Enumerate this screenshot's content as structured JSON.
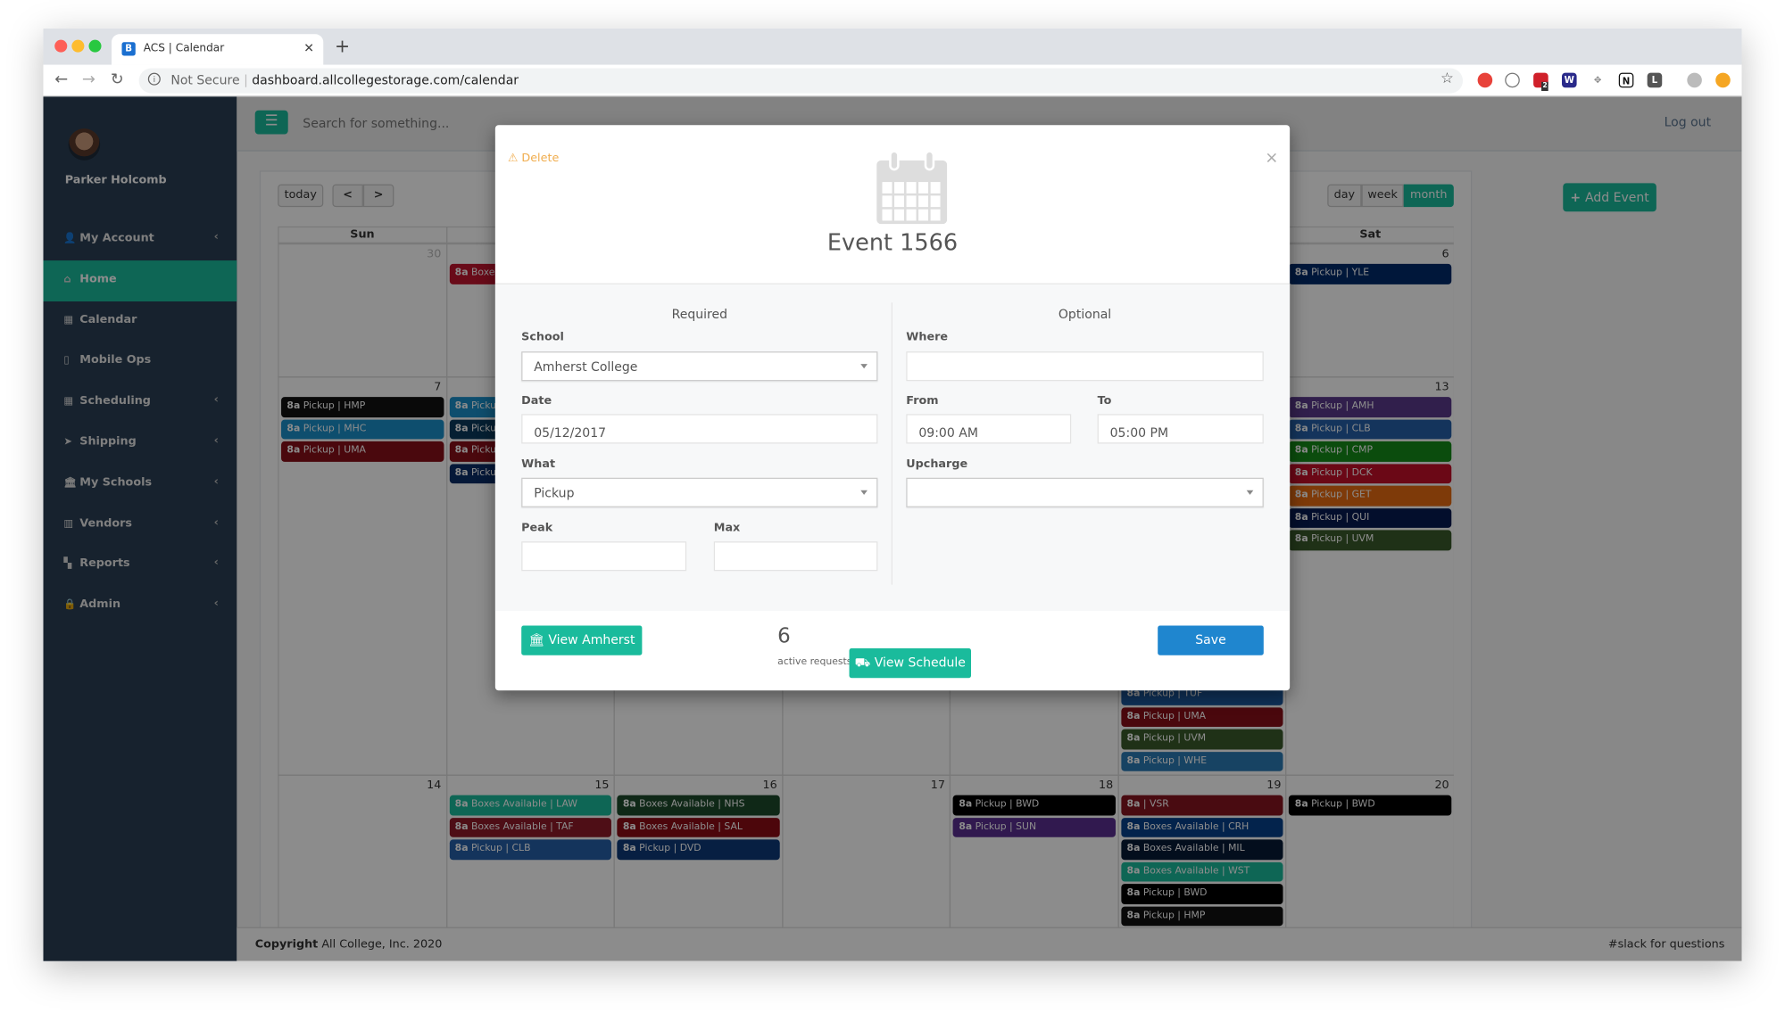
{
  "browser": {
    "tab_title": "ACS | Calendar",
    "favicon_letter": "B",
    "security_label": "Not Secure",
    "url": "dashboard.allcollegestorage.com/calendar",
    "extension_badge": "2"
  },
  "sidebar": {
    "user_name": "Parker Holcomb",
    "items": [
      {
        "label": "My Account",
        "icon": "user-icon",
        "chevron": true
      },
      {
        "label": "Home",
        "icon": "home-icon",
        "chevron": false,
        "active": true
      },
      {
        "label": "Calendar",
        "icon": "calendar-icon",
        "chevron": false
      },
      {
        "label": "Mobile Ops",
        "icon": "mobile-icon",
        "chevron": false
      },
      {
        "label": "Scheduling",
        "icon": "calendar-icon",
        "chevron": true
      },
      {
        "label": "Shipping",
        "icon": "paper-plane-icon",
        "chevron": true
      },
      {
        "label": "My Schools",
        "icon": "institution-icon",
        "chevron": true
      },
      {
        "label": "Vendors",
        "icon": "building-icon",
        "chevron": true
      },
      {
        "label": "Reports",
        "icon": "grid-icon",
        "chevron": true
      },
      {
        "label": "Admin",
        "icon": "lock-icon",
        "chevron": true
      }
    ]
  },
  "topbar": {
    "search_placeholder": "Search for something...",
    "logout": "Log out"
  },
  "calendar": {
    "today": "today",
    "prev": "<",
    "next": ">",
    "views": [
      {
        "label": "day"
      },
      {
        "label": "week"
      },
      {
        "label": "month",
        "active": true
      }
    ],
    "add_event": "Add Event",
    "day_headers": [
      "Sun",
      "",
      "",
      "",
      "",
      "",
      "Sat"
    ],
    "weeks": [
      {
        "days": [
          {
            "num": "30",
            "other": true,
            "events": []
          },
          {
            "num": "",
            "events": [
              {
                "time": "8a",
                "title": "Boxes",
                "color": "#c0142e"
              }
            ]
          },
          {
            "num": "",
            "events": []
          },
          {
            "num": "",
            "events": []
          },
          {
            "num": "",
            "events": []
          },
          {
            "num": "",
            "events": []
          },
          {
            "num": "6",
            "events": [
              {
                "time": "8a",
                "title": "Pickup | YLE",
                "color": "#002a6a"
              }
            ]
          }
        ]
      },
      {
        "days": [
          {
            "num": "7",
            "events": [
              {
                "time": "8a",
                "title": "Pickup | HMP",
                "color": "#111111"
              },
              {
                "time": "8a",
                "title": "Pickup | MHC",
                "color": "#1a8fc9"
              },
              {
                "time": "8a",
                "title": "Pickup | UMA",
                "color": "#881018"
              }
            ]
          },
          {
            "num": "",
            "events": [
              {
                "time": "8a",
                "title": "Pickup",
                "color": "#1a8fc9"
              },
              {
                "time": "8a",
                "title": "Pickup",
                "color": "#0a3a5c"
              },
              {
                "time": "8a",
                "title": "Pickup",
                "color": "#881018"
              },
              {
                "time": "8a",
                "title": "Pickup",
                "color": "#0a2d66"
              }
            ]
          },
          {
            "num": "",
            "events": []
          },
          {
            "num": "",
            "events": []
          },
          {
            "num": "",
            "events": []
          },
          {
            "num": "",
            "events": [],
            "late_events": [
              {
                "time": "8a",
                "title": "Pickup | TUF",
                "color": "#1c5aa0"
              },
              {
                "time": "8a",
                "title": "Pickup | UMA",
                "color": "#881018"
              },
              {
                "time": "8a",
                "title": "Pickup | UVM",
                "color": "#3a5a2a"
              },
              {
                "time": "8a",
                "title": "Pickup | WHE",
                "color": "#2b7ab5"
              }
            ]
          },
          {
            "num": "13",
            "events": [
              {
                "time": "8a",
                "title": "Pickup | AMH",
                "color": "#5a3a8a"
              },
              {
                "time": "8a",
                "title": "Pickup | CLB",
                "color": "#2560a8"
              },
              {
                "time": "8a",
                "title": "Pickup | CMP",
                "color": "#158a18"
              },
              {
                "time": "8a",
                "title": "Pickup | DCK",
                "color": "#c41028"
              },
              {
                "time": "8a",
                "title": "Pickup | GET",
                "color": "#e56a12"
              },
              {
                "time": "8a",
                "title": "Pickup | QUI",
                "color": "#061a50"
              },
              {
                "time": "8a",
                "title": "Pickup | UVM",
                "color": "#3a5a2a"
              }
            ]
          }
        ]
      },
      {
        "days": [
          {
            "num": "14",
            "events": []
          },
          {
            "num": "15",
            "events": [
              {
                "time": "8a",
                "title": "Boxes Available | LAW",
                "color": "#1abb9c"
              },
              {
                "time": "8a",
                "title": "Boxes Available | TAF",
                "color": "#8e1a28"
              },
              {
                "time": "8a",
                "title": "Pickup | CLB",
                "color": "#2560a8"
              }
            ]
          },
          {
            "num": "16",
            "events": [
              {
                "time": "8a",
                "title": "Boxes Available | NHS",
                "color": "#1c4a2a"
              },
              {
                "time": "8a",
                "title": "Boxes Available | SAL",
                "color": "#8a0c14"
              },
              {
                "time": "8a",
                "title": "Pickup | DVD",
                "color": "#0e3a78"
              }
            ]
          },
          {
            "num": "17",
            "events": []
          },
          {
            "num": "18",
            "events": [
              {
                "time": "8a",
                "title": "Pickup | BWD",
                "color": "#000000"
              },
              {
                "time": "8a",
                "title": "Pickup | SUN",
                "color": "#5a2e90"
              }
            ]
          },
          {
            "num": "19",
            "events": [
              {
                "time": "8a",
                "title": "| VSR",
                "color": "#861420"
              },
              {
                "time": "8a",
                "title": "Boxes Available | CRH",
                "color": "#06408a"
              },
              {
                "time": "8a",
                "title": "Boxes Available | MIL",
                "color": "#061a36"
              },
              {
                "time": "8a",
                "title": "Boxes Available | WST",
                "color": "#1abb9c"
              },
              {
                "time": "8a",
                "title": "Pickup | BWD",
                "color": "#000000"
              },
              {
                "time": "8a",
                "title": "Pickup | HMP",
                "color": "#111111"
              }
            ]
          },
          {
            "num": "20",
            "events": [
              {
                "time": "8a",
                "title": "Pickup | BWD",
                "color": "#000000"
              }
            ]
          }
        ]
      }
    ]
  },
  "footer": {
    "copyright_bold": "Copyright",
    "copyright_text": "All College, Inc. 2020",
    "right": "#slack for questions"
  },
  "modal": {
    "delete": "Delete",
    "close": "×",
    "title": "Event 1566",
    "required_heading": "Required",
    "optional_heading": "Optional",
    "school": {
      "label": "School",
      "value": "Amherst College"
    },
    "date": {
      "label": "Date",
      "value": "05/12/2017"
    },
    "what": {
      "label": "What",
      "value": "Pickup"
    },
    "peak": {
      "label": "Peak",
      "value": ""
    },
    "max": {
      "label": "Max",
      "value": ""
    },
    "where": {
      "label": "Where",
      "value": ""
    },
    "from": {
      "label": "From",
      "value": "09:00 AM"
    },
    "to": {
      "label": "To",
      "value": "05:00 PM"
    },
    "upcharge": {
      "label": "Upcharge",
      "value": ""
    },
    "view_school": "View Amherst",
    "active_count": "6",
    "active_label": "active requests",
    "view_schedule": "View Schedule",
    "save": "Save"
  },
  "colors": {
    "accent": "#1abb9c",
    "primary": "#1f86cf",
    "warning": "#f0ad4e",
    "sidebar": "#2a3f54"
  }
}
